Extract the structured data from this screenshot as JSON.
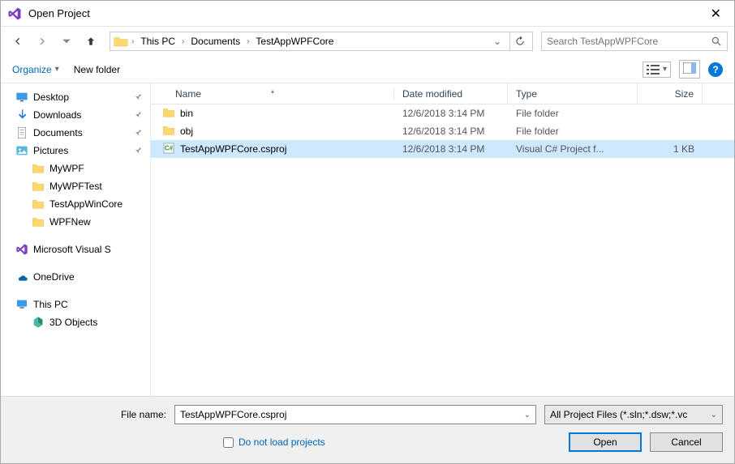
{
  "window": {
    "title": "Open Project"
  },
  "nav": {
    "breadcrumbs": [
      "This PC",
      "Documents",
      "TestAppWPFCore"
    ],
    "search_placeholder": "Search TestAppWPFCore"
  },
  "toolbar": {
    "organize": "Organize",
    "new_folder": "New folder"
  },
  "tree": {
    "items": [
      {
        "label": "Desktop",
        "icon": "desktop",
        "pinned": true
      },
      {
        "label": "Downloads",
        "icon": "download",
        "pinned": true
      },
      {
        "label": "Documents",
        "icon": "document",
        "pinned": true
      },
      {
        "label": "Pictures",
        "icon": "pictures",
        "pinned": true
      },
      {
        "label": "MyWPF",
        "icon": "folder",
        "sub": true
      },
      {
        "label": "MyWPFTest",
        "icon": "folder",
        "sub": true
      },
      {
        "label": "TestAppWinCore",
        "icon": "folder",
        "sub": true,
        "truncated": true
      },
      {
        "label": "WPFNew",
        "icon": "folder",
        "sub": true
      }
    ],
    "groups": [
      {
        "label": "Microsoft Visual S",
        "icon": "vs"
      },
      {
        "label": "OneDrive",
        "icon": "onedrive"
      },
      {
        "label": "This PC",
        "icon": "thispc"
      },
      {
        "label": "3D Objects",
        "icon": "3d",
        "sub": true
      }
    ]
  },
  "columns": {
    "name": "Name",
    "date": "Date modified",
    "type": "Type",
    "size": "Size"
  },
  "files": [
    {
      "name": "bin",
      "date": "12/6/2018 3:14 PM",
      "type": "File folder",
      "size": "",
      "icon": "folder",
      "selected": false
    },
    {
      "name": "obj",
      "date": "12/6/2018 3:14 PM",
      "type": "File folder",
      "size": "",
      "icon": "folder",
      "selected": false
    },
    {
      "name": "TestAppWPFCore.csproj",
      "date": "12/6/2018 3:14 PM",
      "type": "Visual C# Project f...",
      "size": "1 KB",
      "icon": "csproj",
      "selected": true
    }
  ],
  "bottom": {
    "filename_label": "File name:",
    "filename_value": "TestAppWPFCore.csproj",
    "filter": "All Project Files (*.sln;*.dsw;*.vc",
    "checkbox": "Do not load projects",
    "open": "Open",
    "cancel": "Cancel"
  }
}
